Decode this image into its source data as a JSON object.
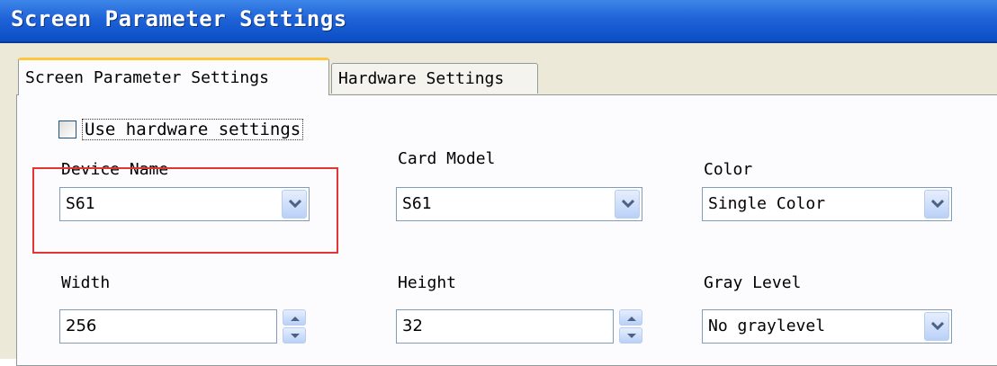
{
  "window": {
    "title": "Screen Parameter Settings"
  },
  "tabs": [
    {
      "label": "Screen Parameter Settings",
      "active": true
    },
    {
      "label": "Hardware Settings",
      "active": false
    }
  ],
  "use_hardware": {
    "label": "Use hardware settings",
    "checked": false
  },
  "fields": {
    "device_name": {
      "label": "Device Name",
      "value": "S61",
      "icon": "chevron-down-icon"
    },
    "card_model": {
      "label": "Card Model",
      "value": "S61",
      "icon": "chevron-down-icon"
    },
    "color": {
      "label": "Color",
      "value": "Single Color",
      "icon": "chevron-down-icon"
    },
    "width": {
      "label": "Width",
      "value": "256"
    },
    "height": {
      "label": "Height",
      "value": "32"
    },
    "gray_level": {
      "label": "Gray Level",
      "value": "No graylevel",
      "icon": "chevron-down-icon"
    }
  },
  "colors": {
    "title_bar": "#1f63d8",
    "highlight": "#e53434",
    "dialog_bg": "#ece9d8"
  }
}
